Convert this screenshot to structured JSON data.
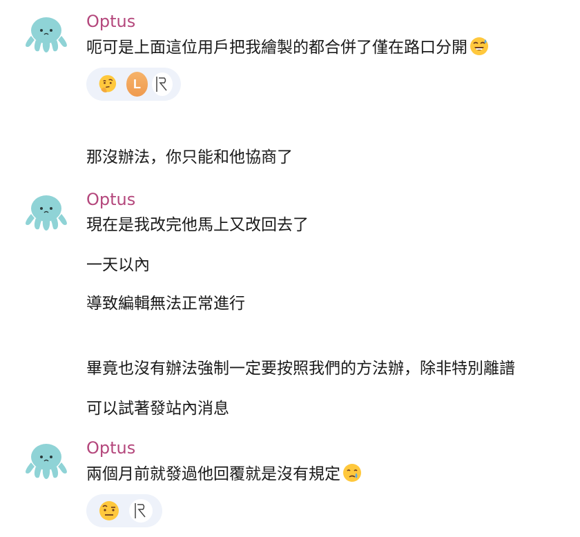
{
  "messages": [
    {
      "author": "Optus",
      "lines": [
        "呃可是上面這位用戶把我繪製的都合併了僅在路口分開"
      ],
      "trailing_emoji": "sweat-smile-emoji",
      "reactions": [
        {
          "type": "emoji",
          "icon": "thinking-face-emoji"
        },
        {
          "type": "avatar",
          "initial": "L"
        },
        {
          "type": "logo",
          "icon": "wiki-logo-icon"
        }
      ]
    },
    {
      "author": "",
      "lines": [
        "那沒辦法，你只能和他協商了"
      ]
    },
    {
      "author": "Optus",
      "lines": [
        "現在是我改完他馬上又改回去了",
        "一天以內",
        "導致編輯無法正常進行"
      ]
    },
    {
      "author": "",
      "lines": [
        "畢竟也沒有辦法強制一定要按照我們的方法辦，除非特別離譜",
        "可以試著發站內消息"
      ]
    },
    {
      "author": "Optus",
      "lines": [
        "兩個月前就發過他回覆就是沒有規定"
      ],
      "trailing_emoji": "crying-face-emoji",
      "reactions": [
        {
          "type": "emoji",
          "icon": "raised-eyebrow-emoji"
        },
        {
          "type": "logo",
          "icon": "wiki-logo-icon"
        }
      ]
    }
  ],
  "colors": {
    "author": "#b4477c",
    "text": "#1a1a1a",
    "reaction_bg": "#eef2fa",
    "avatar_octopus": "#8fd3d6"
  }
}
